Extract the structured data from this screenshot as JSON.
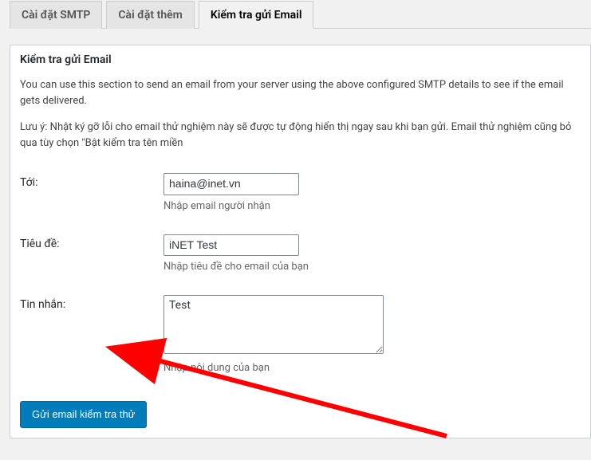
{
  "tabs": [
    {
      "label": "Cài đặt SMTP",
      "active": false
    },
    {
      "label": "Cài đặt thêm",
      "active": false
    },
    {
      "label": "Kiểm tra gửi Email",
      "active": true
    }
  ],
  "panel": {
    "heading": "Kiểm tra gửi Email",
    "intro": "You can use this section to send an email from your server using the above configured SMTP details to see if the email gets delivered.",
    "note": "Lưu ý: Nhật ký gỡ lỗi cho email thử nghiệm này sẽ được tự động hiển thị ngay sau khi bạn gửi. Email thử nghiệm cũng bỏ qua tùy chọn \"Bật kiểm tra tên miền",
    "fields": {
      "to": {
        "label": "Tới:",
        "value": "haina@inet.vn",
        "help": "Nhập email người nhận"
      },
      "subject": {
        "label": "Tiêu đề:",
        "value": "iNET Test",
        "help": "Nhập tiêu đề cho email của bạn"
      },
      "message": {
        "label": "Tin nhắn:",
        "value": "Test",
        "help": "Nhập nội dung của bạn"
      }
    },
    "submit_label": "Gửi email kiểm tra thử"
  },
  "colors": {
    "primary": "#007cba",
    "arrow": "#ff0000"
  }
}
